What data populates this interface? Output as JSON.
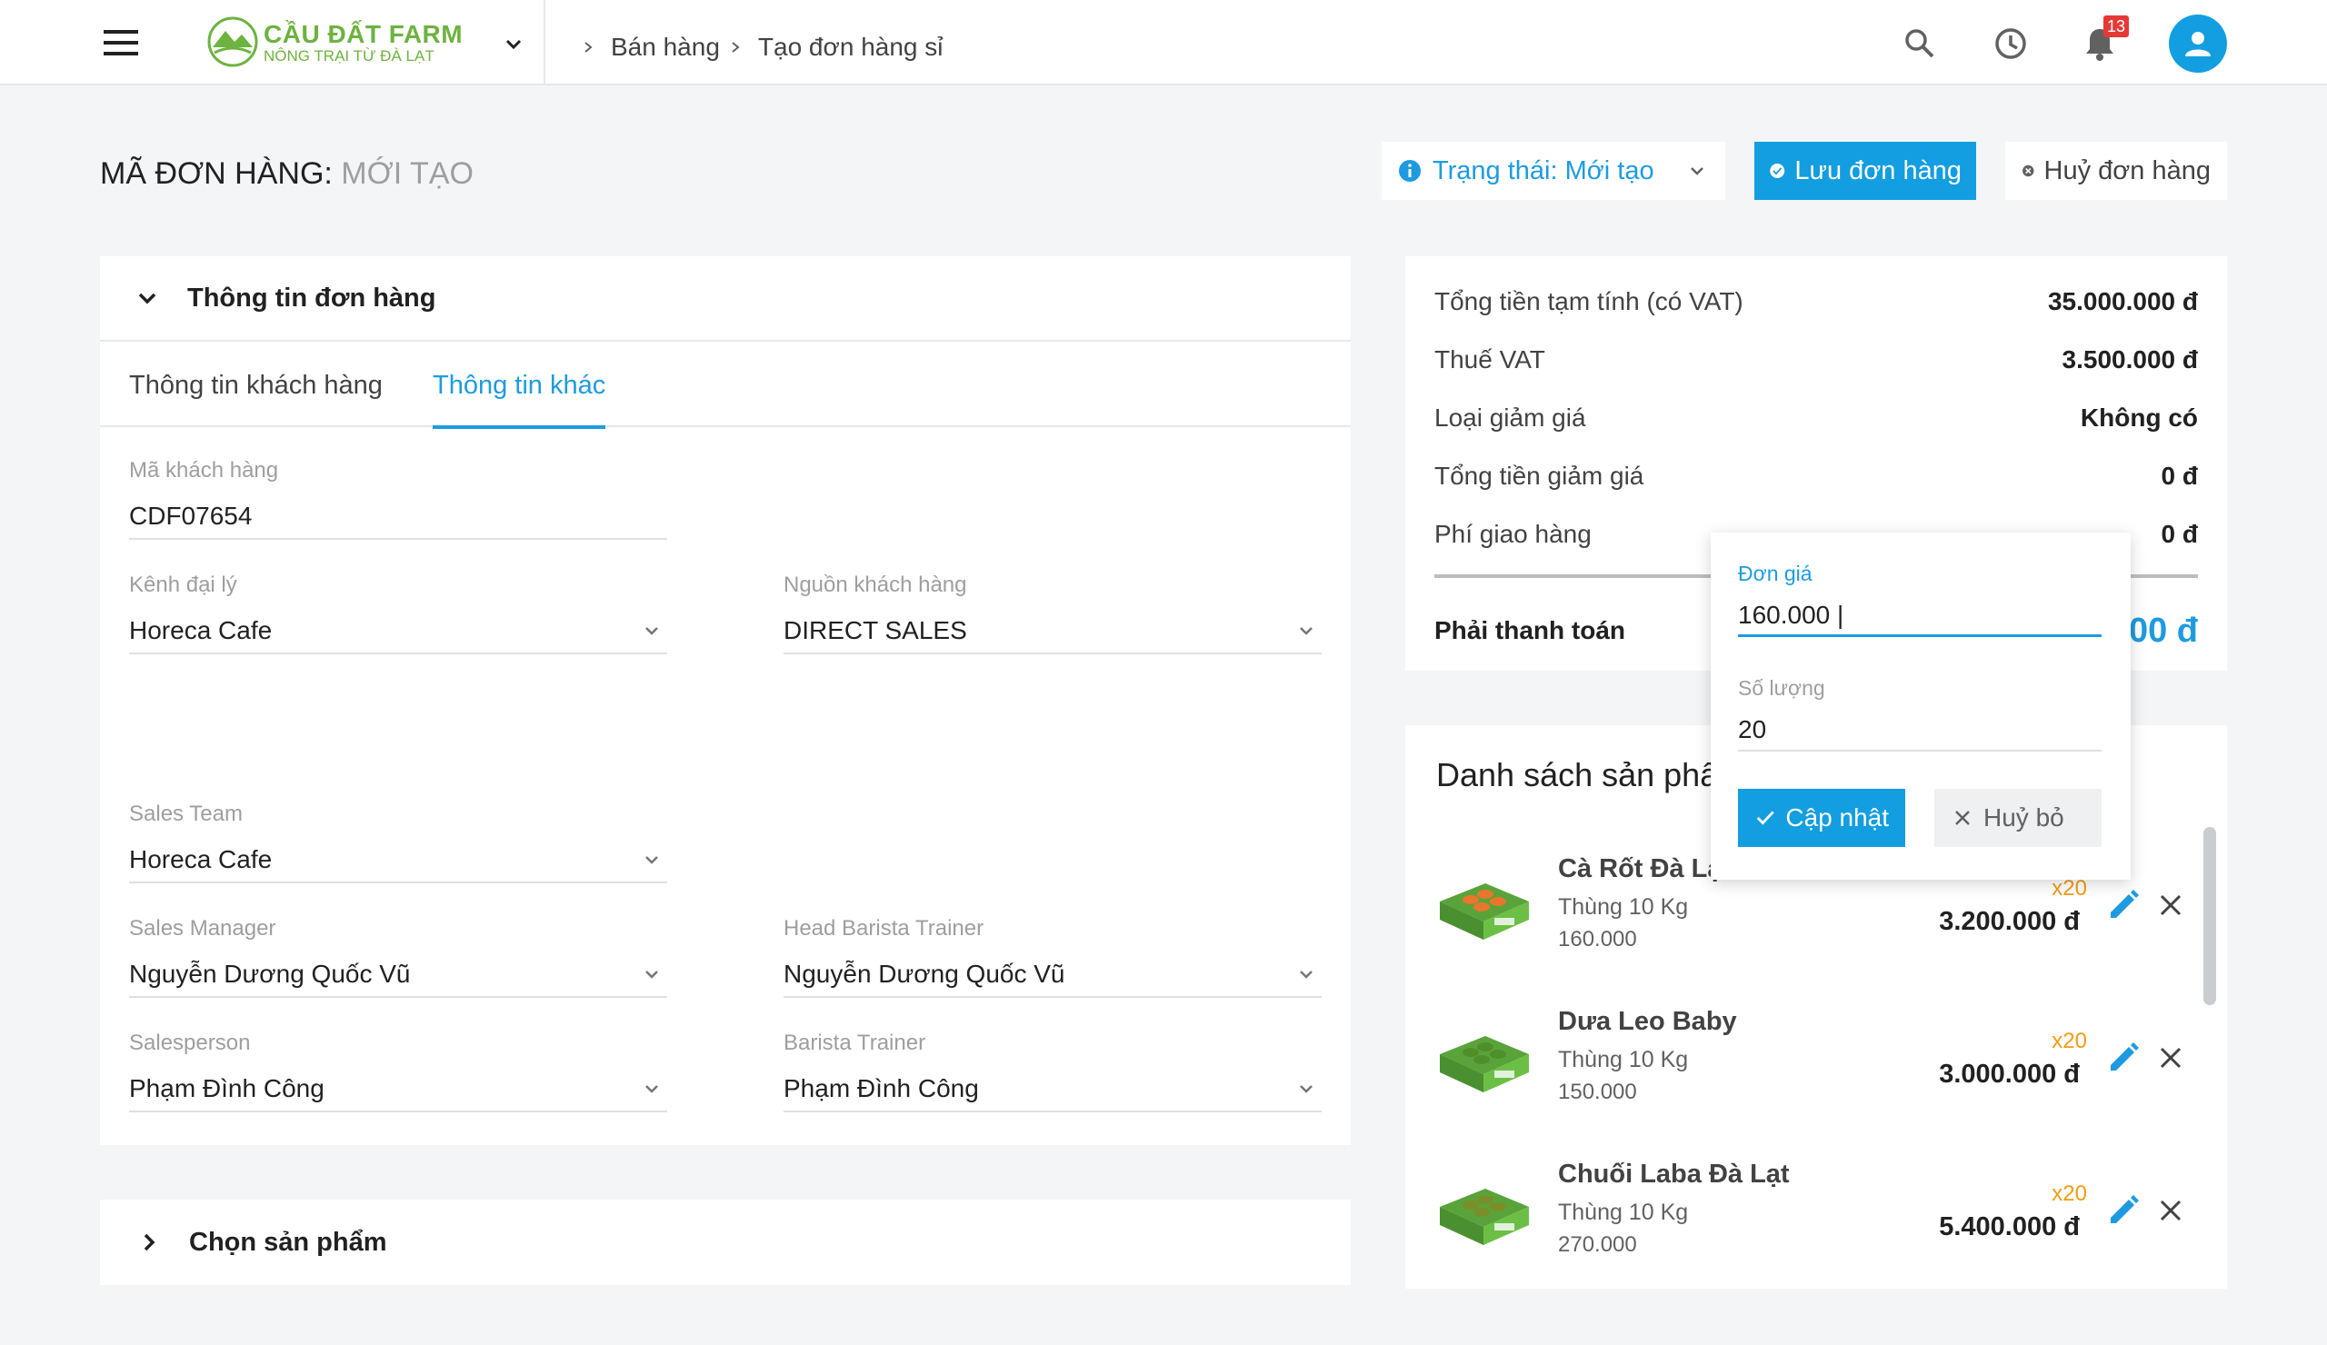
{
  "brand": {
    "title": "CẦU ĐẤT FARM",
    "subtitle": "NÔNG TRẠI TỪ ĐÀ LẠT",
    "color": "#6db33f"
  },
  "breadcrumb": [
    "Bán hàng",
    "Tạo đơn hàng sỉ"
  ],
  "header": {
    "notification_count": "13",
    "accent_color": "#129ee0"
  },
  "order": {
    "label": "MÃ ĐƠN HÀNG:",
    "code": "MỚI TẠO",
    "status_label": "Trạng thái: Mới tạo",
    "save_label": "Lưu đơn hàng",
    "cancel_label": "Huỷ đơn hàng"
  },
  "info_card": {
    "title": "Thông tin đơn hàng",
    "tabs": [
      {
        "label": "Thông tin khách hàng",
        "active": false
      },
      {
        "label": "Thông tin khác",
        "active": true
      }
    ],
    "fields": {
      "customer_code": {
        "label": "Mã khách hàng",
        "value": "CDF07654"
      },
      "agent_channel": {
        "label": "Kênh đại lý",
        "value": "Horeca Cafe"
      },
      "customer_source": {
        "label": "Nguồn khách hàng",
        "value": "DIRECT SALES"
      },
      "sales_team": {
        "label": "Sales Team",
        "value": "Horeca Cafe"
      },
      "sales_manager": {
        "label": "Sales Manager",
        "value": "Nguyễn Dương Quốc Vũ"
      },
      "head_barista_trainer": {
        "label": "Head Barista Trainer",
        "value": "Nguyễn Dương Quốc Vũ"
      },
      "salesperson": {
        "label": "Salesperson",
        "value": "Phạm Đình Công"
      },
      "barista_trainer": {
        "label": "Barista Trainer",
        "value": "Phạm Đình Công"
      }
    }
  },
  "choose_products": {
    "title": "Chọn sản phẩm"
  },
  "summary": {
    "rows": [
      {
        "label": "Tổng tiền tạm tính (có VAT)",
        "value": "35.000.000 đ"
      },
      {
        "label": "Thuế VAT",
        "value": "3.500.000 đ"
      },
      {
        "label": "Loại giảm giá",
        "value": "Không có"
      },
      {
        "label": "Tổng tiền giảm giá",
        "value": "0 đ"
      },
      {
        "label": "Phí giao hàng",
        "value": "0 đ"
      }
    ],
    "total_label": "Phải thanh toán",
    "total_value_visible": "000 đ"
  },
  "products": {
    "title": "Danh sách sản phẩm",
    "items": [
      {
        "name": "Cà Rốt Đà Lạt",
        "unit": "Thùng 10 Kg",
        "price": "160.000",
        "qty": "x20",
        "total": "3.200.000 đ",
        "produce_color": "#e8762c"
      },
      {
        "name": "Dưa Leo Baby",
        "unit": "Thùng 10 Kg",
        "price": "150.000",
        "qty": "x20",
        "total": "3.000.000 đ",
        "produce_color": "#4f8f2a"
      },
      {
        "name": "Chuối Laba Đà Lạt",
        "unit": "Thùng 10 Kg",
        "price": "270.000",
        "qty": "x20",
        "total": "5.400.000 đ",
        "produce_color": "#7a8f2a"
      }
    ]
  },
  "edit_popover": {
    "price_label": "Đơn giá",
    "price_value": "160.000 |",
    "quantity_label": "Số lượng",
    "quantity_value": "20",
    "update_label": "Cập nhật",
    "cancel_label": "Huỷ bỏ"
  }
}
